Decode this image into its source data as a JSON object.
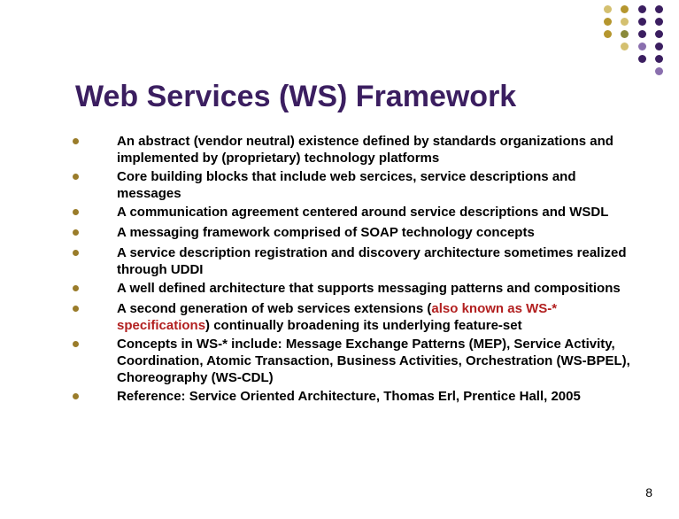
{
  "title": "Web Services (WS) Framework",
  "items": [
    {
      "text": "An abstract (vendor neutral) existence defined by standards organizations and implemented by (proprietary) technology platforms"
    },
    {
      "text": "Core building blocks that include web sercices, service descriptions and messages"
    },
    {
      "text": "A communication agreement centered around service descriptions and WSDL"
    },
    {
      "text": "A messaging framework comprised of SOAP technology concepts"
    },
    {
      "text": "A service description registration and discovery architecture sometimes realized through UDDI"
    },
    {
      "text": "A well defined architecture that supports messaging patterns and compositions"
    },
    {
      "pre": "A second generation of web services extensions (",
      "hl": "also known as WS-* specifications",
      "post": ") continually broadening its underlying feature-set"
    },
    {
      "text": "Concepts in WS-* include: Message Exchange Patterns (MEP), Service Activity, Coordination, Atomic Transaction, Business Activities, Orchestration (WS-BPEL), Choreography (WS-CDL)"
    },
    {
      "text": "Reference: Service Oriented Architecture, Thomas Erl, Prentice Hall, 2005"
    }
  ],
  "page_number": "8"
}
